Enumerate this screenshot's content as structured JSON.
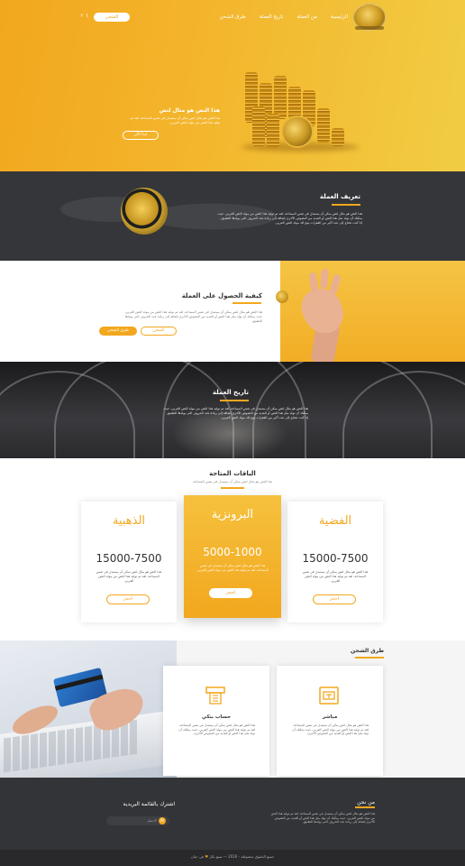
{
  "header": {
    "nav": [
      "الرئيسية",
      "من العملة",
      "تاريخ العملة",
      "طرق الشحن"
    ],
    "charge_button": "الشحن",
    "social": [
      "f",
      "t"
    ]
  },
  "hero": {
    "title": "هذا النص هو مثال لنص",
    "text": "هذا النص هو مثال لنص يمكن أن يستبدل في نفس المساحة، لقد تم توليد هذا النص من مولد النص العربي.",
    "button": "ابدأ الآن"
  },
  "definition": {
    "title": "تعريف العملة",
    "text": "هذا النص هو مثال لنص يمكن أن يستبدل في نفس المساحة، لقد تم توليد هذا النص من مولد النص العربي، حيث يمكنك أن تولد مثل هذا النص أو العديد من النصوص الأخرى إضافة إلى زيادة عدد الحروف التى يولدها التطبيق. إذا كنت تحتاج إلى عدد أكبر من الفقرات يتيح لك مولد النص العربي."
  },
  "how": {
    "title": "كيفية الحصول على العملة",
    "text": "هذا النص هو مثال لنص يمكن أن يستبدل في نفس المساحة، لقد تم توليد هذا النص من مولد النص العربي، حيث يمكنك أن تولد مثل هذا النص أو العديد من النصوص الأخرى إضافة إلى زيادة عدد الحروف التى يولدها التطبيق.",
    "btn_outline": "الشحن",
    "btn_filled": "طرق الشحن"
  },
  "history": {
    "title": "تاريخ العملة",
    "text": "هذا النص هو مثال لنص يمكن أن يستبدل في نفس المساحة، لقد تم توليد هذا النص من مولد النص العربي، حيث يمكنك أن تولد مثل هذا النص أو العديد من النصوص الأخرى إضافة إلى زيادة عدد الحروف التى يولدها التطبيق. إذا كنت تحتاج إلى عدد أكبر من الفقرات يتيح لك مولد النص العربي."
  },
  "packages": {
    "title": "الباقات المتاحة",
    "subtitle": "هذا النص هو مثال لنص يمكن أن يستبدل في نفس المساحة",
    "items": [
      {
        "name": "الفضية",
        "range": "15000-7500",
        "text": "هذا النص هو مثال لنص يمكن أن يستبدل في نفس المساحة، لقد تم توليد هذا النص من مولد النص العربي.",
        "button": "احجز"
      },
      {
        "name": "البرونزية",
        "range": "5000-1000",
        "text": "هذا النص هو مثال لنص يمكن أن يستبدل في نفس المساحة، لقد تم توليد هذا النص من مولد النص العربي.",
        "button": "احجز"
      },
      {
        "name": "الذهبية",
        "range": "15000-7500",
        "text": "هذا النص هو مثال لنص يمكن أن يستبدل في نفس المساحة، لقد تم توليد هذا النص من مولد النص العربي.",
        "button": "احجز"
      }
    ]
  },
  "methods": {
    "title": "طرق الشحن",
    "items": [
      {
        "name": "مباشر",
        "icon": "atm-icon",
        "text": "هذا النص هو مثال لنص يمكن أن يستبدل في نفس المساحة، لقد تم توليد هذا النص من مولد النص العربي، حيث يمكنك أن تولد مثل هذا النص أو العديد من النصوص الأخرى."
      },
      {
        "name": "حساب بنكي",
        "icon": "bank-machine-icon",
        "text": "هذا النص هو مثال لنص يمكن أن يستبدل في نفس المساحة، لقد تم توليد هذا النص من مولد النص العربي، حيث يمكنك أن تولد مثل هذا النص أو العديد من النصوص الأخرى."
      }
    ]
  },
  "footer": {
    "about_title": "من نحن",
    "about_text": "هذا النص هو مثال لنص يمكن أن يستبدل في نفس المساحة، لقد تم توليد هذا النص من مولد النص العربي، حيث يمكنك أن تولد مثل هذا النص أو العديد من النصوص الأخرى إضافة إلى زيادة عدد الحروف التى يولدها التطبيق.",
    "newsletter_title": "اشترك بالقائمة البريدية",
    "newsletter_placeholder": "الايميل",
    "copyright": "جميع الحقوق محفوظة - 2016",
    "made_by": "صنع بكل",
    "made_by_suffix": "في حيان"
  },
  "colors": {
    "accent": "#f2a71e",
    "dark": "#35363a"
  }
}
